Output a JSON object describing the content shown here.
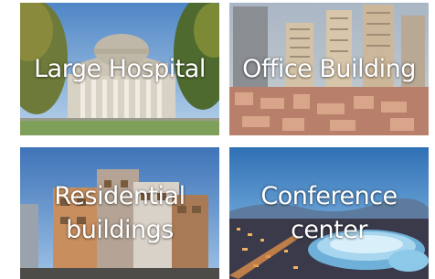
{
  "tiles": [
    {
      "label": "Large Hospital",
      "image": "domed-building-photo"
    },
    {
      "label": "Office Building",
      "image": "city-towers-photo"
    },
    {
      "label": "Residential buildings",
      "image": "modern-apartment-photo"
    },
    {
      "label": "Conference center",
      "image": "night-city-arena-photo"
    }
  ]
}
